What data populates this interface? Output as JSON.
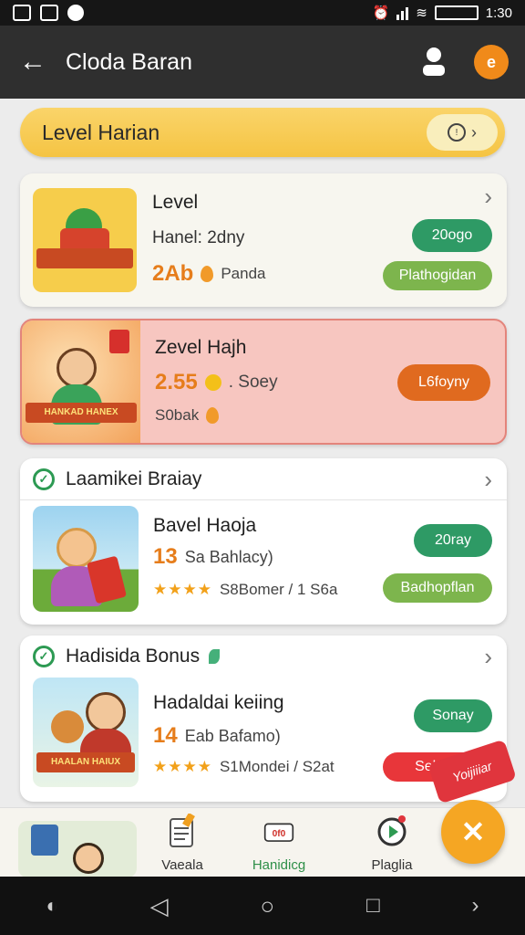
{
  "status_bar": {
    "time": "1:30"
  },
  "app_bar": {
    "title": "Cloda Baran"
  },
  "banner": {
    "title": "Level Harian"
  },
  "cards": [
    {
      "title": "Level",
      "line2": "Hanel: 2dny",
      "value": "2Ab",
      "line3_label": "Panda",
      "button_primary": "20ogo",
      "button_secondary": "Plathogidan"
    },
    {
      "title": "Zevel Hajh",
      "value": "2.55",
      "line2_label": ". Soey",
      "line3": "S0bak",
      "button": "L6foyny",
      "thumb_text": "HANKAD HANEX"
    }
  ],
  "sections": [
    {
      "header": "Laamikei Braiay",
      "title": "Bavel Haoja",
      "value": "13",
      "value_label": "Sa Bahlacy)",
      "stars": "★★★★",
      "rating_text": "S8Bomer / 1 S6a",
      "button_primary": "20ray",
      "button_secondary": "Badhopflan"
    },
    {
      "header": "Hadisida Bonus",
      "title": "Hadaldai keiing",
      "value": "14",
      "value_label": "Eab Bafamo)",
      "stars": "★★★★",
      "rating_text": "S1Mondei / S2at",
      "button_primary": "Sonay",
      "button_secondary": "Sekdm",
      "thumb_text": "HAALAN HAIUX"
    }
  ],
  "corner_badge": "Yoijiiiar",
  "bottom_nav": [
    {
      "label": "Vaeala"
    },
    {
      "label": "Hanidicg"
    },
    {
      "label": "Plaglia"
    }
  ]
}
